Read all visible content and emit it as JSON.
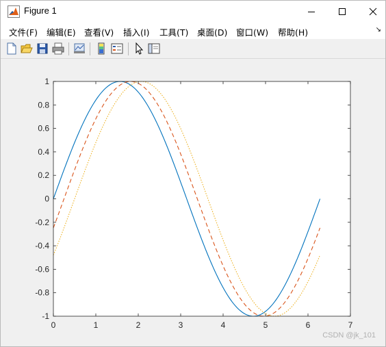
{
  "window": {
    "title": "Figure 1"
  },
  "menu": {
    "items": [
      "文件(F)",
      "编辑(E)",
      "查看(V)",
      "插入(I)",
      "工具(T)",
      "桌面(D)",
      "窗口(W)",
      "帮助(H)"
    ],
    "overflow_glyph": "↘"
  },
  "toolbar": {
    "buttons": [
      "new-figure",
      "open-file",
      "save-figure",
      "print-figure",
      "link-plot",
      "insert-colorbar",
      "insert-legend",
      "edit-plot",
      "show-plot-tools"
    ]
  },
  "watermark": "CSDN @jk_101",
  "chart_data": {
    "type": "line",
    "title": "",
    "xlabel": "",
    "ylabel": "",
    "xlim": [
      0,
      7
    ],
    "ylim": [
      -1,
      1
    ],
    "x_ticks": [
      0,
      1,
      2,
      3,
      4,
      5,
      6,
      7
    ],
    "y_ticks": [
      -1,
      -0.8,
      -0.6,
      -0.4,
      -0.2,
      0,
      0.2,
      0.4,
      0.6,
      0.8,
      1
    ],
    "y_tick_labels": [
      "-1",
      "-0.8",
      "-0.6",
      "-0.4",
      "-0.2",
      "0",
      "0.2",
      "0.4",
      "0.6",
      "0.8",
      "1"
    ],
    "grid": false,
    "box": true,
    "x_range": [
      0,
      6.2832
    ],
    "series": [
      {
        "function": "sin(x)",
        "color": "#0072BD",
        "line_style": "solid"
      },
      {
        "function": "sin(x-0.25)",
        "color": "#D95319",
        "line_style": "dashed"
      },
      {
        "function": "sin(x-0.5)",
        "color": "#EDB120",
        "line_style": "dotted"
      }
    ]
  }
}
